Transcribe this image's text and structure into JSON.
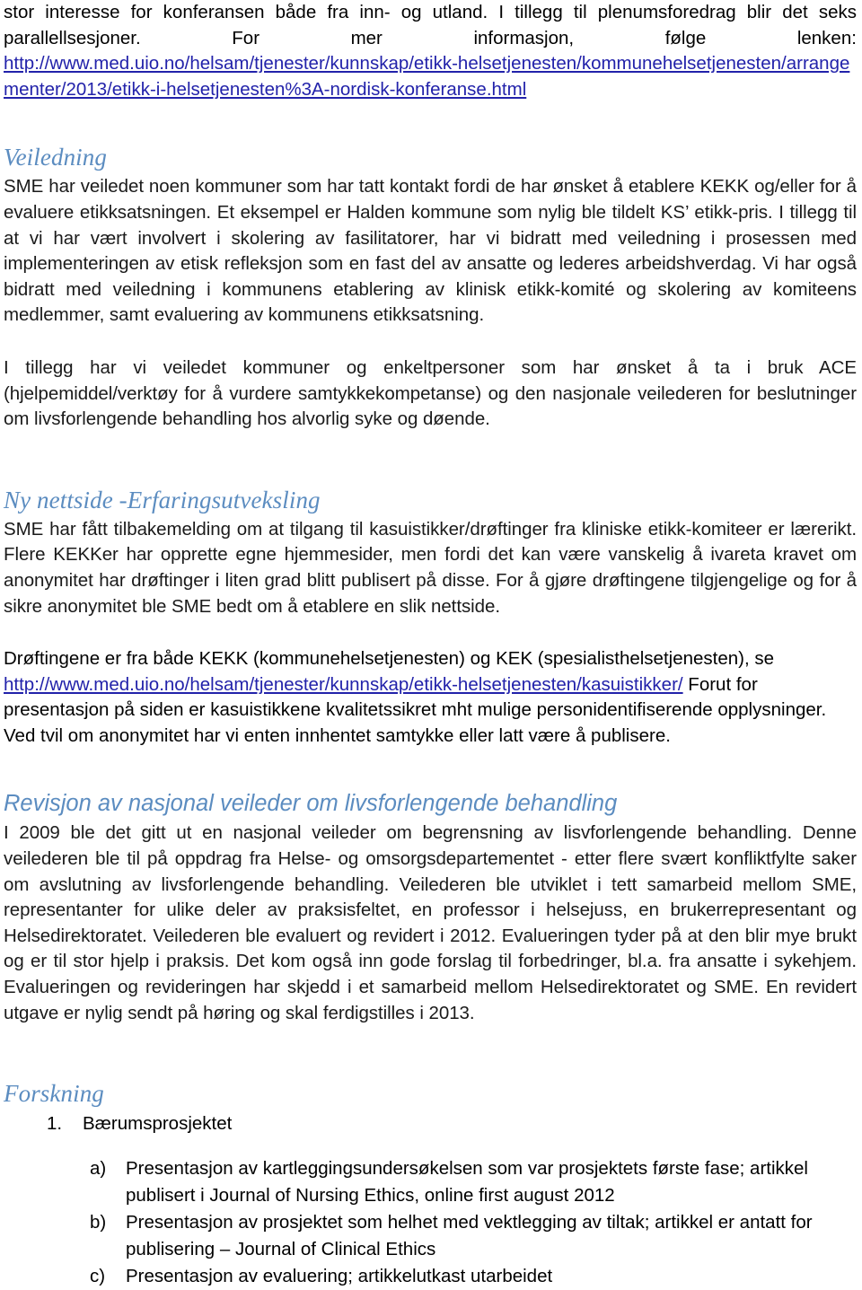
{
  "document": {
    "lead": {
      "line1": "stor interesse for konferansen både fra inn- og utland. I tillegg til plenumsforedrag blir det seks",
      "line2_words": [
        "parallellsesjoner.",
        "For",
        "mer",
        "informasjon,",
        "følge",
        "lenken:"
      ]
    },
    "link_top": "http://www.med.uio.no/helsam/tjenester/kunnskap/etikk-helsetjenesten/kommunehelsetjenesten/arrangementer/2013/etikk-i-helsetjenesten%3A-nordisk-konferanse.html",
    "sections": [
      {
        "heading": "Veiledning",
        "heading_style": "serif-italic",
        "paragraphs": [
          "SME har veiledet noen kommuner som har tatt kontakt fordi de har ønsket å etablere KEKK og/eller for å evaluere etikksatsningen. Et eksempel er Halden kommune som nylig ble tildelt KS’ etikk-pris. I tillegg til at vi har vært involvert i skolering av fasilitatorer, har vi bidratt med veiledning i prosessen med implementeringen av etisk refleksjon som en fast del av ansatte og lederes arbeidshverdag. Vi har også bidratt med veiledning i kommunens etablering av klinisk etikk-komité og skolering av komiteens medlemmer, samt evaluering av kommunens etikksatsning.",
          "I tillegg har vi veiledet kommuner og enkeltpersoner som har ønsket å ta i bruk ACE (hjelpemiddel/verktøy for å vurdere samtykkekompetanse) og den nasjonale veilederen for beslutninger om livsforlengende behandling hos alvorlig syke og døende."
        ]
      },
      {
        "heading": "Ny nettside -Erfaringsutveksling",
        "heading_style": "serif-italic",
        "paragraphs": [
          "SME har fått tilbakemelding om at tilgang til kasuistikker/drøftinger fra kliniske etikk-komiteer er lærerikt. Flere KEKKer har opprette egne hjemmesider, men fordi det kan være vanskelig å ivareta kravet om anonymitet har drøftinger i liten grad blitt publisert på disse. For å gjøre drøftingene tilgjengelige og for å sikre anonymitet ble SME bedt om å etablere en slik nettside."
        ]
      }
    ],
    "kasuistikker_block": {
      "intro": "Drøftingene er fra både KEKK (kommunehelsetjenesten) og KEK (spesialisthelsetjenesten), se",
      "link": "http://www.med.uio.no/helsam/tjenester/kunnskap/etikk-helsetjenesten/kasuistikker/",
      "after_link": " Forut for presentasjon på siden er kasuistikkene kvalitetssikret mht mulige personidentifiserende opplysninger. Ved tvil om anonymitet har vi enten innhentet samtykke eller latt være å publisere."
    },
    "revisjon": {
      "heading": "Revisjon av nasjonal veileder om livsforlengende behandling",
      "heading_style": "sans-italic",
      "paragraph": "I 2009 ble det gitt ut en nasjonal veileder om begrensning av lisvforlengende behandling. Denne veilederen ble til på oppdrag fra Helse- og omsorgsdepartementet - etter flere svært konfliktfylte saker om avslutning av livsforlengende behandling. Veilederen ble utviklet i tett samarbeid mellom SME, representanter for ulike deler av praksisfeltet, en professor i helsejuss, en brukerrepresentant og Helsedirektoratet. Veilederen ble evaluert og revidert i 2012. Evalueringen tyder på at den blir mye brukt og er til stor hjelp i praksis. Det kom også inn gode forslag til forbedringer, bl.a. fra ansatte i sykehjem. Evalueringen og revideringen har skjedd i et samarbeid mellom Helsedirektoratet og SME. En revidert utgave er nylig sendt på høring og skal ferdigstilles i 2013."
    },
    "forskning": {
      "heading": "Forskning",
      "heading_style": "serif-italic",
      "items": [
        {
          "marker": "1.",
          "text": "Bærumsprosjektet"
        }
      ],
      "subitems": [
        {
          "marker": "a)",
          "text": "Presentasjon av kartleggingsundersøkelsen som var prosjektets første fase; artikkel publisert i Journal of Nursing Ethics, online first august 2012"
        },
        {
          "marker": "b)",
          "text": "Presentasjon av prosjektet som helhet med vektlegging av tiltak; artikkel er antatt for publisering – Journal of Clinical Ethics"
        },
        {
          "marker": "c)",
          "text": "Presentasjon av evaluering; artikkelutkast utarbeidet"
        }
      ]
    },
    "colors": {
      "heading_blue": "#5b8cc0",
      "link_blue": "#2222aa",
      "body_text": "#1a1a1a",
      "page_background": "#ffffff"
    }
  }
}
